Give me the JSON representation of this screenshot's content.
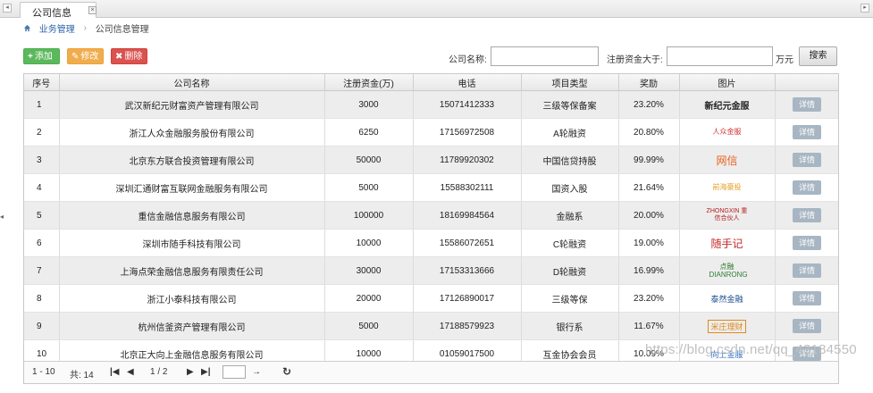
{
  "tabs": [
    {
      "label": "公司信息",
      "close": "×"
    }
  ],
  "breadcrumb": {
    "items": [
      "业务管理",
      "公司信息管理"
    ],
    "sep": "›"
  },
  "toolbar": {
    "add": {
      "icon": "+",
      "label": "添加"
    },
    "edit": {
      "icon": "✎",
      "label": "修改"
    },
    "delete": {
      "icon": "✖",
      "label": "删除"
    },
    "company_name_label": "公司名称:",
    "company_name_value": "",
    "capital_label": "注册资金大于:",
    "capital_value": "",
    "unit": "万元",
    "search": "搜索"
  },
  "table": {
    "columns": [
      "序号",
      "公司名称",
      "注册资金(万)",
      "电话",
      "项目类型",
      "奖励",
      "图片",
      ""
    ],
    "detail_label": "详情",
    "rows": [
      {
        "idx": "1",
        "name": "武汉新纪元财富资产管理有限公司",
        "capital": "3000",
        "phone": "15071412333",
        "type": "三级等保备案",
        "reward": "23.20%",
        "logo": "新纪元金服"
      },
      {
        "idx": "2",
        "name": "浙江人众金融服务股份有限公司",
        "capital": "6250",
        "phone": "17156972508",
        "type": "A轮融资",
        "reward": "20.80%",
        "logo": "人众金服"
      },
      {
        "idx": "3",
        "name": "北京东方联合投资管理有限公司",
        "capital": "50000",
        "phone": "11789920302",
        "type": "中国信贷持股",
        "reward": "99.99%",
        "logo": "网信"
      },
      {
        "idx": "4",
        "name": "深圳汇通财富互联网金融服务有限公司",
        "capital": "5000",
        "phone": "15588302111",
        "type": "国资入股",
        "reward": "21.64%",
        "logo": "前海豪投"
      },
      {
        "idx": "5",
        "name": "重信金融信息服务有限公司",
        "capital": "100000",
        "phone": "18169984564",
        "type": "金融系",
        "reward": "20.00%",
        "logo": "ZHONGXIN 重信合伙人"
      },
      {
        "idx": "6",
        "name": "深圳市随手科技有限公司",
        "capital": "10000",
        "phone": "15586072651",
        "type": "C轮融资",
        "reward": "19.00%",
        "logo": "随手记"
      },
      {
        "idx": "7",
        "name": "上海点荣金融信息服务有限责任公司",
        "capital": "30000",
        "phone": "17153313666",
        "type": "D轮融资",
        "reward": "16.99%",
        "logo": "点融 DIANRONG"
      },
      {
        "idx": "8",
        "name": "浙江小泰科技有限公司",
        "capital": "20000",
        "phone": "17126890017",
        "type": "三级等保",
        "reward": "23.20%",
        "logo": "泰然金融"
      },
      {
        "idx": "9",
        "name": "杭州信釜资产管理有限公司",
        "capital": "5000",
        "phone": "17188579923",
        "type": "银行系",
        "reward": "11.67%",
        "logo": "米庄理财"
      },
      {
        "idx": "10",
        "name": "北京正大向上金融信息服务有限公司",
        "capital": "10000",
        "phone": "01059017500",
        "type": "互金协会会员",
        "reward": "10.09%",
        "logo": "向上金服"
      }
    ]
  },
  "pager": {
    "range": "1 - 10",
    "total": "共: 14",
    "page": "1 / 2",
    "first": "|◀",
    "prev": "◀",
    "next": "▶",
    "last": "▶|",
    "go": "→",
    "refresh": "↻"
  },
  "side_handle": "◂",
  "watermark": "https://blog.csdn.net/qq_43184550"
}
